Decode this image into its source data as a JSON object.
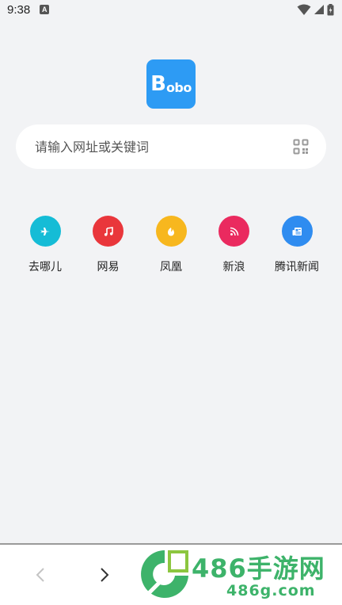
{
  "status_bar": {
    "time": "9:38",
    "notification_icon_letter": "A",
    "icons": [
      "notification-icon",
      "wifi-icon",
      "signal-icon",
      "battery-icon"
    ]
  },
  "logo": {
    "first": "B",
    "rest": "obo"
  },
  "search": {
    "placeholder": "请输入网址或关键词",
    "value": "",
    "icon": "qr-scan-icon"
  },
  "shortcuts": [
    {
      "label": "去哪儿",
      "icon": "airplane-icon",
      "color": "#15bcd6"
    },
    {
      "label": "网易",
      "icon": "music-note-icon",
      "color": "#e9363b"
    },
    {
      "label": "凤凰",
      "icon": "phoenix-icon",
      "color": "#f7b71e"
    },
    {
      "label": "新浪",
      "icon": "rss-icon",
      "color": "#ea2a5f"
    },
    {
      "label": "腾讯新闻",
      "icon": "newspaper-icon",
      "color": "#2f8cf0"
    }
  ],
  "bottom_bar": {
    "back_icon": "chevron-left-icon",
    "forward_icon": "chevron-right-icon"
  },
  "watermark": {
    "main": "486手游网",
    "sub": "486g.com"
  }
}
